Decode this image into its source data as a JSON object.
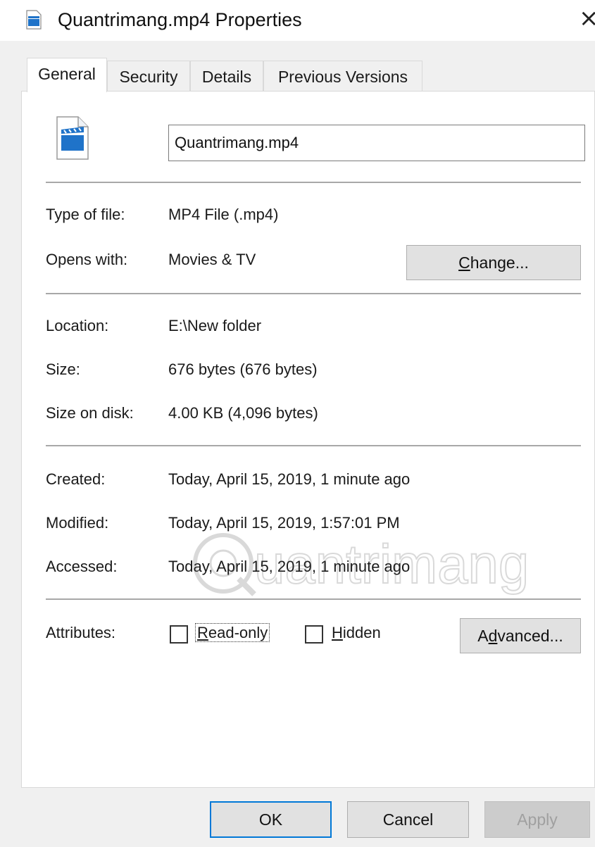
{
  "window": {
    "title": "Quantrimang.mp4 Properties",
    "close_glyph": "×",
    "icon": "video-file-icon"
  },
  "tabs": [
    {
      "label": "General",
      "active": true
    },
    {
      "label": "Security",
      "active": false
    },
    {
      "label": "Details",
      "active": false
    },
    {
      "label": "Previous Versions",
      "active": false
    }
  ],
  "general": {
    "file_icon": "video-file-icon",
    "file_name": "Quantrimang.mp4",
    "type_label": "Type of file:",
    "type_value": "MP4 File (.mp4)",
    "opens_label": "Opens with:",
    "opens_value": "Movies & TV",
    "change_button_prefix": "C",
    "change_button_rest": "hange...",
    "location_label": "Location:",
    "location_value": "E:\\New folder",
    "size_label": "Size:",
    "size_value": "676 bytes (676 bytes)",
    "size_disk_label": "Size on disk:",
    "size_disk_value": "4.00 KB (4,096 bytes)",
    "created_label": "Created:",
    "created_value": "Today, April 15, 2019, 1 minute ago",
    "modified_label": "Modified:",
    "modified_value": "Today, April 15, 2019, 1:57:01 PM",
    "accessed_label": "Accessed:",
    "accessed_value": "Today, April 15, 2019, 1 minute ago",
    "attributes_label": "Attributes:",
    "readonly_prefix": "R",
    "readonly_rest": "ead-only",
    "readonly_checked": false,
    "hidden_prefix": "H",
    "hidden_rest": "idden",
    "hidden_checked": false,
    "advanced_prefix": "A",
    "advanced_mid": "d",
    "advanced_rest": "vanced..."
  },
  "watermark": {
    "text": "uantrimang"
  },
  "buttons": {
    "ok": "OK",
    "cancel": "Cancel",
    "apply": "Apply"
  },
  "colors": {
    "accent": "#0078d7",
    "file_icon_blue": "#1f73c9"
  }
}
